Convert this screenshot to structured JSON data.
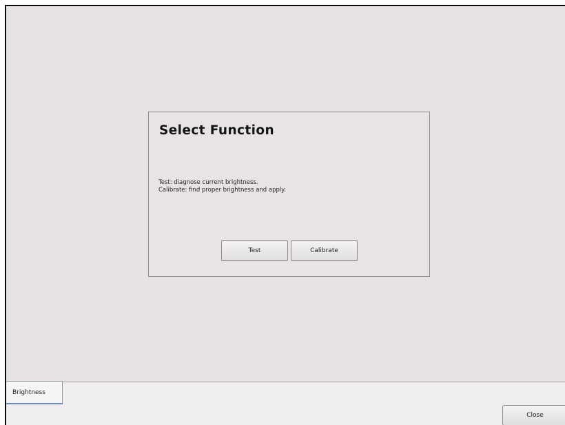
{
  "dialog": {
    "title": "Select Function",
    "description": [
      "Test: diagnose current brightness.",
      "Calibrate: find proper brightness and apply."
    ],
    "buttons": {
      "test_label": "Test",
      "calibrate_label": "Calibrate"
    }
  },
  "tabs": [
    {
      "label": "Brightness",
      "selected": true
    }
  ],
  "footer": {
    "close_label": "Close"
  },
  "colors": {
    "background": "#e7e3e5",
    "tab_selected_underline": "#6b8cc0",
    "frame_border": "#0a0a0a"
  }
}
